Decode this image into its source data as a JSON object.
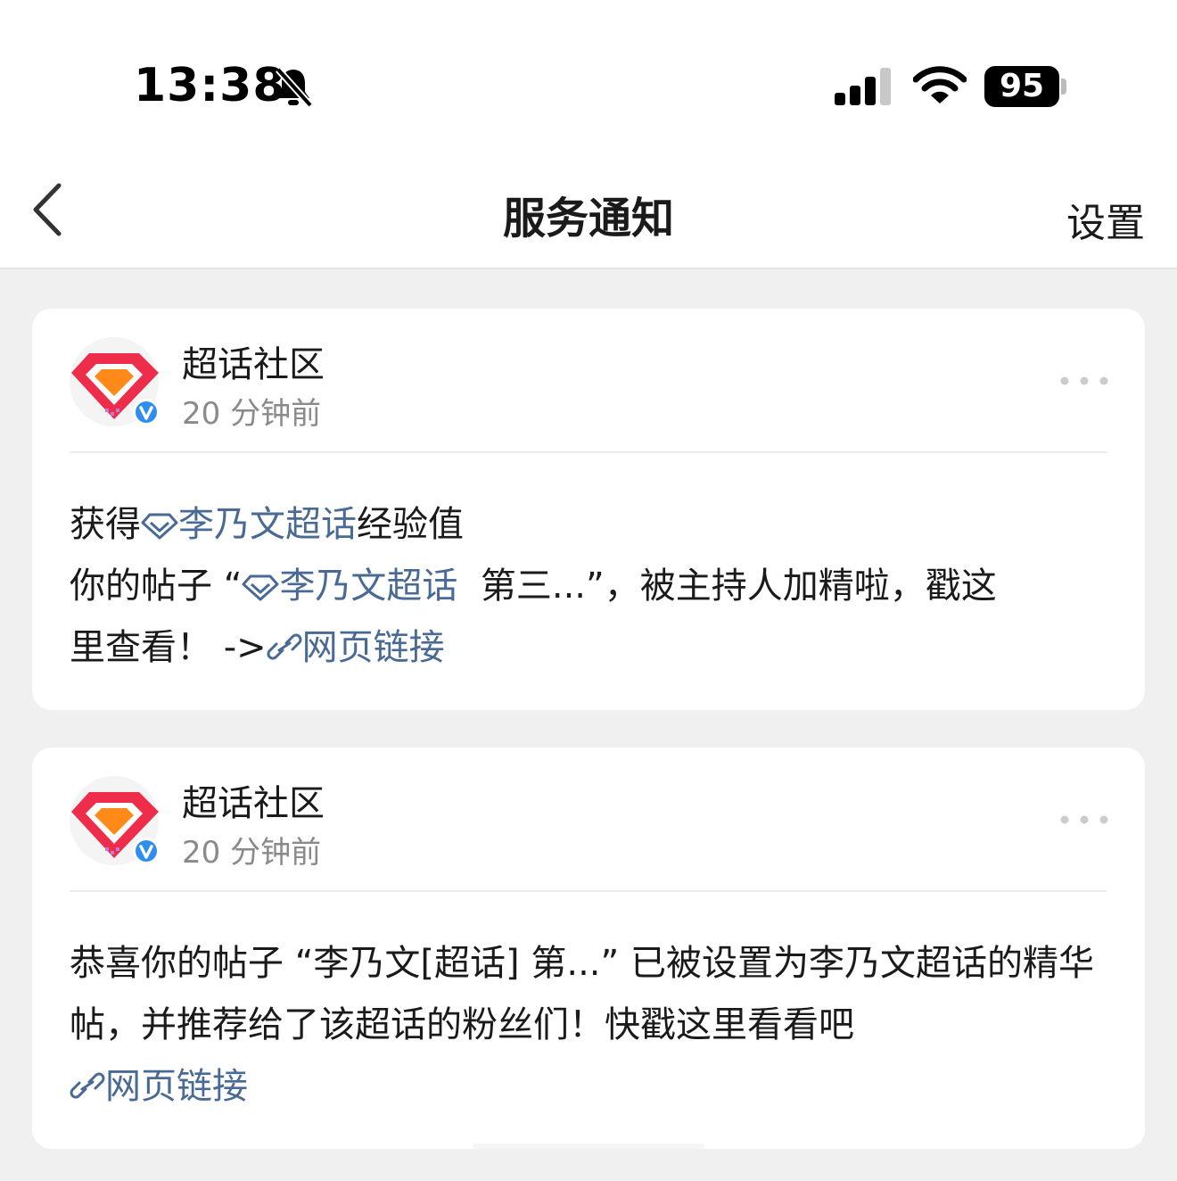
{
  "status_bar": {
    "time": "13:38",
    "battery": "95",
    "icons": [
      "bell-slash-icon",
      "signal-icon",
      "wifi-icon",
      "battery-icon"
    ]
  },
  "nav": {
    "title": "服务通知",
    "settings_label": "设置",
    "back_icon": "chevron-left-icon"
  },
  "colors": {
    "link": "#4a6a96",
    "background": "#f0f0f0",
    "card": "#ffffff"
  },
  "notifications": [
    {
      "sender": "超话社区",
      "time": "20 分钟前",
      "line1_prefix": "获得",
      "line1_link": "李乃文超话",
      "line1_suffix": "经验值",
      "line2_prefix": "你的帖子 “",
      "line2_link": "李乃文超话",
      "line2_suffix": "  第三...”，被主持人加精啦，戳这",
      "line3_prefix": "里查看！ ->",
      "line3_link": "网页链接"
    },
    {
      "sender": "超话社区",
      "time": "20 分钟前",
      "text": "恭喜你的帖子 “李乃文[超话]  第...” 已被设置为李乃文超话的精华帖，并推荐给了该超话的粉丝们！快戳这里看看吧",
      "link": "网页链接"
    }
  ]
}
